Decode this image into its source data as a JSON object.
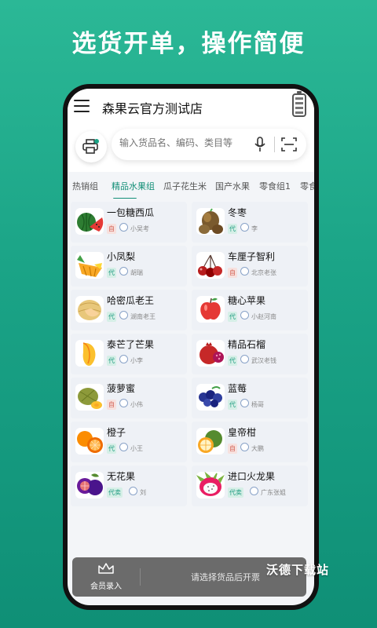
{
  "headline": "选货开单，操作简便",
  "app": {
    "store_title": "森果云官方测试店",
    "search_placeholder": "输入货品名、编码、类目等"
  },
  "tabs": [
    {
      "label": "热销组",
      "active": false
    },
    {
      "label": "精品水果组",
      "active": true
    },
    {
      "label": "瓜子花生米",
      "active": false
    },
    {
      "label": "国产水果",
      "active": false
    },
    {
      "label": "零食组1",
      "active": false
    },
    {
      "label": "零食",
      "active": false
    }
  ],
  "products": [
    {
      "name": "一包糖西瓜",
      "badge": "自",
      "badge_color": "red",
      "seller": "小吴考",
      "fruit": "watermelon"
    },
    {
      "name": "冬枣",
      "badge": "代",
      "badge_color": "green",
      "seller": "李",
      "fruit": "jujube"
    },
    {
      "name": "小凤梨",
      "badge": "代",
      "badge_color": "green",
      "seller": "胡瑞",
      "fruit": "pineapple"
    },
    {
      "name": "车厘子智利",
      "badge": "自",
      "badge_color": "red",
      "seller": "北京老张",
      "fruit": "cherry"
    },
    {
      "name": "哈密瓜老王",
      "badge": "代",
      "badge_color": "green",
      "seller": "湖南老王",
      "fruit": "hami-melon"
    },
    {
      "name": "糖心苹果",
      "badge": "代",
      "badge_color": "green",
      "seller": "小赵河南",
      "fruit": "apple"
    },
    {
      "name": "泰芒了芒果",
      "badge": "代",
      "badge_color": "green",
      "seller": "小李",
      "fruit": "mango"
    },
    {
      "name": "精品石榴",
      "badge": "代",
      "badge_color": "green",
      "seller": "武汉老钱",
      "fruit": "pomegranate"
    },
    {
      "name": "菠萝蜜",
      "badge": "自",
      "badge_color": "red",
      "seller": "小伟",
      "fruit": "jackfruit"
    },
    {
      "name": "蓝莓",
      "badge": "代",
      "badge_color": "green",
      "seller": "杨哥",
      "fruit": "blueberry"
    },
    {
      "name": "橙子",
      "badge": "代",
      "badge_color": "green",
      "seller": "小王",
      "fruit": "orange"
    },
    {
      "name": "皇帝柑",
      "badge": "自",
      "badge_color": "red",
      "seller": "大鹏",
      "fruit": "mandarin"
    },
    {
      "name": "无花果",
      "badge": "代卖",
      "badge_color": "green",
      "seller": "刘",
      "fruit": "fig"
    },
    {
      "name": "进口火龙果",
      "badge": "代卖",
      "badge_color": "green",
      "seller": "广东张姐",
      "fruit": "dragon-fruit"
    }
  ],
  "bottom_bar": {
    "member_label": "会员录入",
    "checkout_hint": "请选择货品后开票"
  },
  "watermark": "沃德下载站",
  "colors": {
    "accent": "#138f77",
    "background": "#1aa386"
  }
}
